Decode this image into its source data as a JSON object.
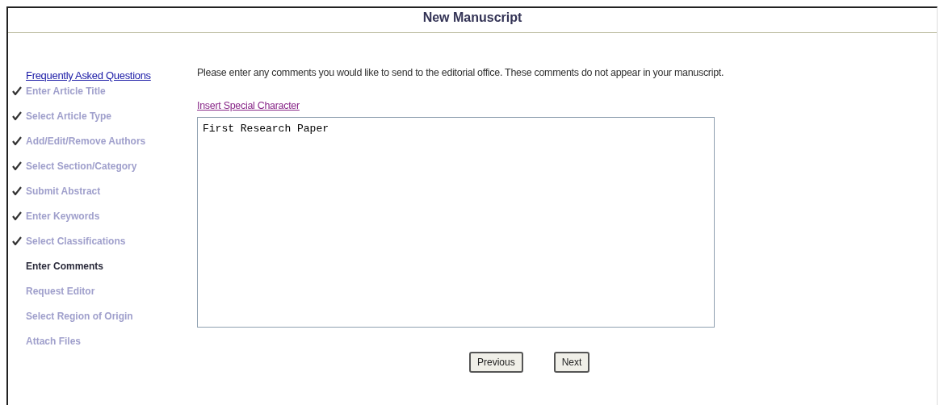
{
  "page_title": "New Manuscript",
  "faq_link": "Frequently Asked Questions",
  "steps": [
    {
      "label": "Enter Article Title",
      "completed": true,
      "selected": false
    },
    {
      "label": "Select Article Type",
      "completed": true,
      "selected": false
    },
    {
      "label": "Add/Edit/Remove Authors",
      "completed": true,
      "selected": false
    },
    {
      "label": "Select Section/Category",
      "completed": true,
      "selected": false
    },
    {
      "label": "Submit Abstract",
      "completed": true,
      "selected": false
    },
    {
      "label": "Enter Keywords",
      "completed": true,
      "selected": false
    },
    {
      "label": "Select Classifications",
      "completed": true,
      "selected": false
    },
    {
      "label": "Enter Comments",
      "completed": false,
      "selected": true
    },
    {
      "label": "Request Editor",
      "completed": false,
      "selected": false
    },
    {
      "label": "Select Region of Origin",
      "completed": false,
      "selected": false
    },
    {
      "label": "Attach Files",
      "completed": false,
      "selected": false
    }
  ],
  "instructions": "Please enter any comments you would like to send to the editorial office. These comments do not appear in your manuscript.",
  "special_char_link": "Insert Special Character",
  "comments": {
    "value": "First Research Paper"
  },
  "buttons": [
    "Previous",
    "Next"
  ]
}
